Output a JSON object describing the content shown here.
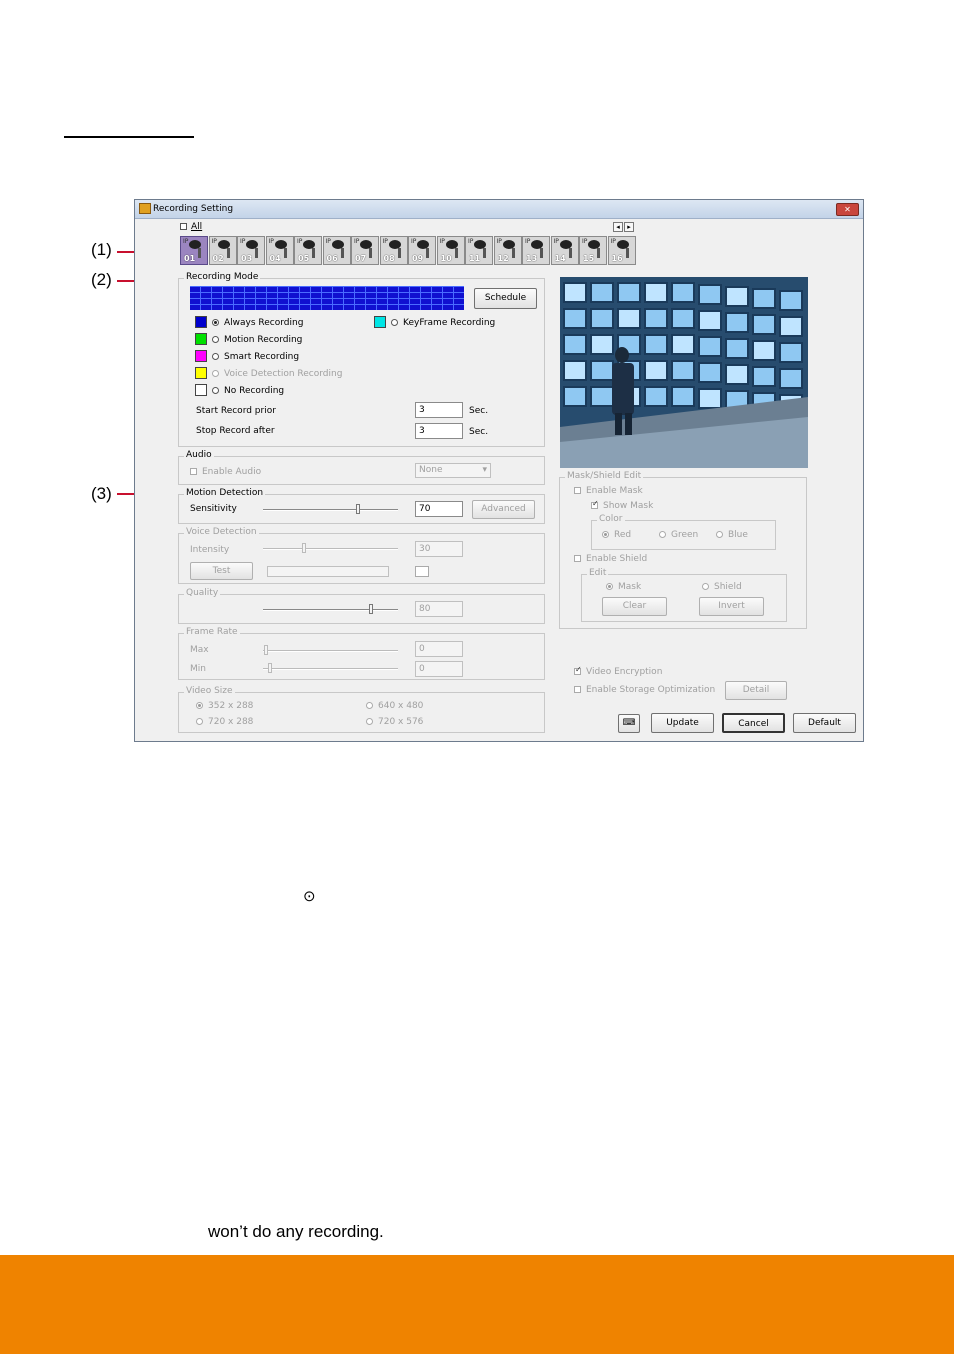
{
  "window": {
    "title": "Recording Setting",
    "close_label": "✕"
  },
  "channels": {
    "all_label": "All",
    "items": [
      "01",
      "02",
      "03",
      "04",
      "05",
      "06",
      "07",
      "08",
      "09",
      "10",
      "11",
      "12",
      "13",
      "14",
      "15",
      "16"
    ],
    "ip_label": "IP",
    "prev_arrow": "◂",
    "next_arrow": "▸"
  },
  "callouts": {
    "c1": "(1)",
    "c2": "(2)",
    "c3": "(3)"
  },
  "recording_mode": {
    "title": "Recording Mode",
    "schedule_button": "Schedule",
    "options": {
      "always": "Always Recording",
      "keyframe": "KeyFrame Recording",
      "motion": "Motion Recording",
      "smart": "Smart Recording",
      "voice": "Voice Detection Recording",
      "none": "No Recording"
    },
    "colors": {
      "always": "#0000cc",
      "keyframe": "#00e5e5",
      "motion": "#00e000",
      "smart": "#ff00ff",
      "voice": "#ffff00",
      "none": "#ffffff"
    },
    "start_prior_label": "Start Record prior",
    "start_prior_value": "3",
    "stop_after_label": "Stop Record after",
    "stop_after_value": "3",
    "unit": "Sec."
  },
  "audio": {
    "title": "Audio",
    "enable_label": "Enable Audio",
    "select_value": "None"
  },
  "motion_detection": {
    "title": "Motion Detection",
    "sensitivity_label": "Sensitivity",
    "sensitivity_value": "70",
    "sensitivity_level": 0.7,
    "advanced_button": "Advanced"
  },
  "voice_detection": {
    "title": "Voice Detection",
    "intensity_label": "Intensity",
    "intensity_value": "30",
    "intensity_level": 0.3,
    "test_button": "Test"
  },
  "quality": {
    "title": "Quality",
    "value": "80",
    "level": 0.8
  },
  "frame_rate": {
    "title": "Frame Rate",
    "max_label": "Max",
    "max_value": "0",
    "min_label": "Min",
    "min_value": "0"
  },
  "video_size": {
    "title": "Video Size",
    "options": [
      "352 x 288",
      "640 x 480",
      "720 x 288",
      "720 x 576"
    ]
  },
  "mask_shield": {
    "title": "Mask/Shield Edit",
    "enable_mask": "Enable Mask",
    "show_mask": "Show Mask",
    "color_title": "Color",
    "colors": [
      "Red",
      "Green",
      "Blue"
    ],
    "enable_shield": "Enable Shield",
    "edit_title": "Edit",
    "mask_option": "Mask",
    "shield_option": "Shield",
    "clear_button": "Clear",
    "invert_button": "Invert"
  },
  "options": {
    "video_encryption": "Video Encryption",
    "storage_opt": "Enable Storage Optimization",
    "detail_button": "Detail"
  },
  "actions": {
    "update": "Update",
    "cancel": "Cancel",
    "default": "Default"
  },
  "body": {
    "radio_glyph": "⊙",
    "text_line": "won’t do any recording."
  }
}
